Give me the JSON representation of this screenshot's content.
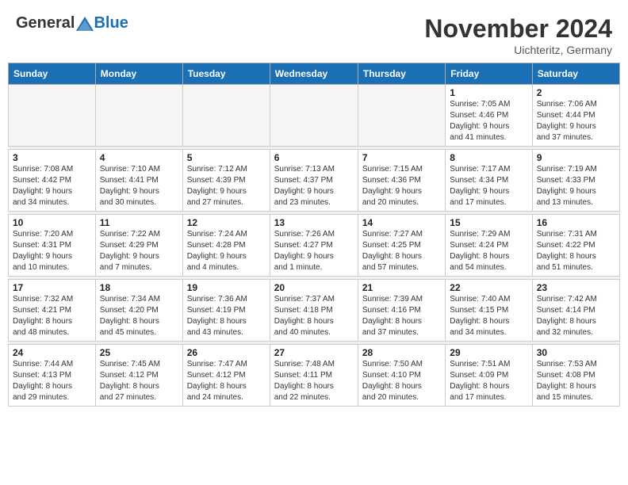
{
  "header": {
    "logo_general": "General",
    "logo_blue": "Blue",
    "month_title": "November 2024",
    "location": "Uichteritz, Germany"
  },
  "weekdays": [
    "Sunday",
    "Monday",
    "Tuesday",
    "Wednesday",
    "Thursday",
    "Friday",
    "Saturday"
  ],
  "weeks": [
    [
      {
        "day": "",
        "info": ""
      },
      {
        "day": "",
        "info": ""
      },
      {
        "day": "",
        "info": ""
      },
      {
        "day": "",
        "info": ""
      },
      {
        "day": "",
        "info": ""
      },
      {
        "day": "1",
        "info": "Sunrise: 7:05 AM\nSunset: 4:46 PM\nDaylight: 9 hours\nand 41 minutes."
      },
      {
        "day": "2",
        "info": "Sunrise: 7:06 AM\nSunset: 4:44 PM\nDaylight: 9 hours\nand 37 minutes."
      }
    ],
    [
      {
        "day": "3",
        "info": "Sunrise: 7:08 AM\nSunset: 4:42 PM\nDaylight: 9 hours\nand 34 minutes."
      },
      {
        "day": "4",
        "info": "Sunrise: 7:10 AM\nSunset: 4:41 PM\nDaylight: 9 hours\nand 30 minutes."
      },
      {
        "day": "5",
        "info": "Sunrise: 7:12 AM\nSunset: 4:39 PM\nDaylight: 9 hours\nand 27 minutes."
      },
      {
        "day": "6",
        "info": "Sunrise: 7:13 AM\nSunset: 4:37 PM\nDaylight: 9 hours\nand 23 minutes."
      },
      {
        "day": "7",
        "info": "Sunrise: 7:15 AM\nSunset: 4:36 PM\nDaylight: 9 hours\nand 20 minutes."
      },
      {
        "day": "8",
        "info": "Sunrise: 7:17 AM\nSunset: 4:34 PM\nDaylight: 9 hours\nand 17 minutes."
      },
      {
        "day": "9",
        "info": "Sunrise: 7:19 AM\nSunset: 4:33 PM\nDaylight: 9 hours\nand 13 minutes."
      }
    ],
    [
      {
        "day": "10",
        "info": "Sunrise: 7:20 AM\nSunset: 4:31 PM\nDaylight: 9 hours\nand 10 minutes."
      },
      {
        "day": "11",
        "info": "Sunrise: 7:22 AM\nSunset: 4:29 PM\nDaylight: 9 hours\nand 7 minutes."
      },
      {
        "day": "12",
        "info": "Sunrise: 7:24 AM\nSunset: 4:28 PM\nDaylight: 9 hours\nand 4 minutes."
      },
      {
        "day": "13",
        "info": "Sunrise: 7:26 AM\nSunset: 4:27 PM\nDaylight: 9 hours\nand 1 minute."
      },
      {
        "day": "14",
        "info": "Sunrise: 7:27 AM\nSunset: 4:25 PM\nDaylight: 8 hours\nand 57 minutes."
      },
      {
        "day": "15",
        "info": "Sunrise: 7:29 AM\nSunset: 4:24 PM\nDaylight: 8 hours\nand 54 minutes."
      },
      {
        "day": "16",
        "info": "Sunrise: 7:31 AM\nSunset: 4:22 PM\nDaylight: 8 hours\nand 51 minutes."
      }
    ],
    [
      {
        "day": "17",
        "info": "Sunrise: 7:32 AM\nSunset: 4:21 PM\nDaylight: 8 hours\nand 48 minutes."
      },
      {
        "day": "18",
        "info": "Sunrise: 7:34 AM\nSunset: 4:20 PM\nDaylight: 8 hours\nand 45 minutes."
      },
      {
        "day": "19",
        "info": "Sunrise: 7:36 AM\nSunset: 4:19 PM\nDaylight: 8 hours\nand 43 minutes."
      },
      {
        "day": "20",
        "info": "Sunrise: 7:37 AM\nSunset: 4:18 PM\nDaylight: 8 hours\nand 40 minutes."
      },
      {
        "day": "21",
        "info": "Sunrise: 7:39 AM\nSunset: 4:16 PM\nDaylight: 8 hours\nand 37 minutes."
      },
      {
        "day": "22",
        "info": "Sunrise: 7:40 AM\nSunset: 4:15 PM\nDaylight: 8 hours\nand 34 minutes."
      },
      {
        "day": "23",
        "info": "Sunrise: 7:42 AM\nSunset: 4:14 PM\nDaylight: 8 hours\nand 32 minutes."
      }
    ],
    [
      {
        "day": "24",
        "info": "Sunrise: 7:44 AM\nSunset: 4:13 PM\nDaylight: 8 hours\nand 29 minutes."
      },
      {
        "day": "25",
        "info": "Sunrise: 7:45 AM\nSunset: 4:12 PM\nDaylight: 8 hours\nand 27 minutes."
      },
      {
        "day": "26",
        "info": "Sunrise: 7:47 AM\nSunset: 4:12 PM\nDaylight: 8 hours\nand 24 minutes."
      },
      {
        "day": "27",
        "info": "Sunrise: 7:48 AM\nSunset: 4:11 PM\nDaylight: 8 hours\nand 22 minutes."
      },
      {
        "day": "28",
        "info": "Sunrise: 7:50 AM\nSunset: 4:10 PM\nDaylight: 8 hours\nand 20 minutes."
      },
      {
        "day": "29",
        "info": "Sunrise: 7:51 AM\nSunset: 4:09 PM\nDaylight: 8 hours\nand 17 minutes."
      },
      {
        "day": "30",
        "info": "Sunrise: 7:53 AM\nSunset: 4:08 PM\nDaylight: 8 hours\nand 15 minutes."
      }
    ]
  ]
}
